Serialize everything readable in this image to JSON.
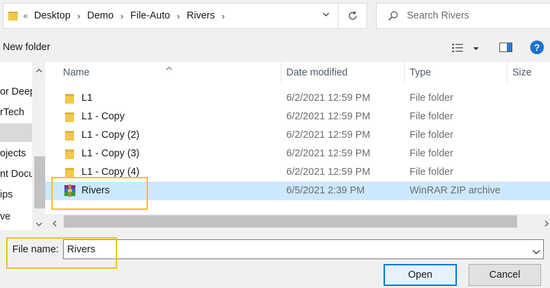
{
  "address_bar": {
    "overflow_glyph": "«",
    "breadcrumbs": [
      "Desktop",
      "Demo",
      "File-Auto",
      "Rivers"
    ]
  },
  "search": {
    "placeholder": "Search Rivers"
  },
  "toolbar": {
    "new_folder_label": "New folder",
    "help_glyph": "?"
  },
  "nav_pane": {
    "items": [
      "or Deep",
      "rTech",
      "",
      "ojects",
      "nt Docu",
      "ips",
      "ve"
    ]
  },
  "file_list": {
    "columns": [
      "Name",
      "Date modified",
      "Type",
      "Size"
    ],
    "rows": [
      {
        "name": "L1",
        "date": "6/2/2021 12:59 PM",
        "type": "File folder",
        "icon": "folder-icon"
      },
      {
        "name": "L1 - Copy",
        "date": "6/2/2021 12:59 PM",
        "type": "File folder",
        "icon": "folder-icon"
      },
      {
        "name": "L1 - Copy (2)",
        "date": "6/2/2021 12:59 PM",
        "type": "File folder",
        "icon": "folder-icon"
      },
      {
        "name": "L1 - Copy (3)",
        "date": "6/2/2021 12:59 PM",
        "type": "File folder",
        "icon": "folder-icon"
      },
      {
        "name": "L1 - Copy (4)",
        "date": "6/2/2021 12:59 PM",
        "type": "File folder",
        "icon": "folder-icon"
      },
      {
        "name": "Rivers",
        "date": "6/5/2021 2:39 PM",
        "type": "WinRAR ZIP archive",
        "icon": "winrar-archive-icon",
        "selected": true
      }
    ]
  },
  "file_name": {
    "label": "File name:",
    "value": "Rivers"
  },
  "buttons": {
    "open": "Open",
    "cancel": "Cancel"
  },
  "colors": {
    "selection": "#cce8ff",
    "highlight": "#f4c01e",
    "accent": "#0078d7",
    "folder": "#f2c94c"
  }
}
